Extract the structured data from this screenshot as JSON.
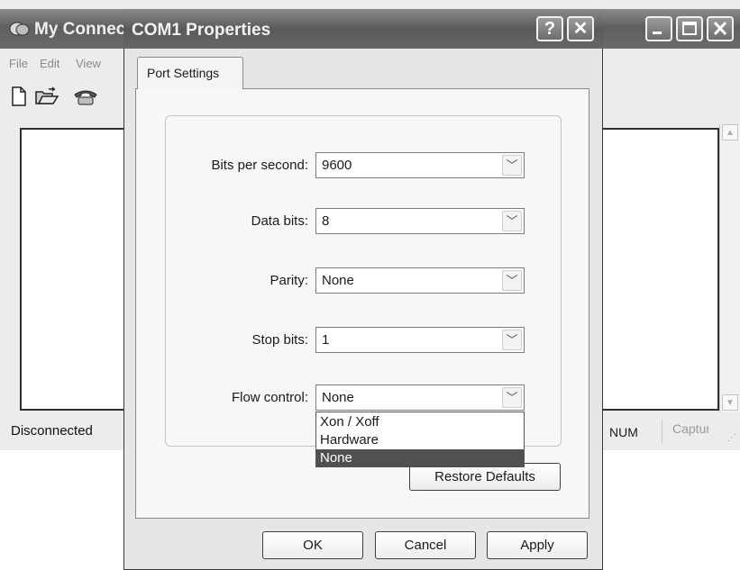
{
  "background_window": {
    "title": "My Connection",
    "menu": [
      "File",
      "Edit",
      "View"
    ],
    "status": {
      "connection": "Disconnected",
      "num": "NUM",
      "capture": "Capture"
    }
  },
  "dialog": {
    "title": "COM1 Properties",
    "help_button": "?",
    "close_button": "✕",
    "tab": "Port Settings",
    "fields": [
      {
        "label": "Bits per second:",
        "value": "9600"
      },
      {
        "label": "Data bits:",
        "value": "8"
      },
      {
        "label": "Parity:",
        "value": "None"
      },
      {
        "label": "Stop bits:",
        "value": "1"
      },
      {
        "label": "Flow control:",
        "value": "None"
      }
    ],
    "flow_control_options": [
      "Xon / Xoff",
      "Hardware",
      "None"
    ],
    "selected_option": "None",
    "restore_defaults": "Restore Defaults",
    "ok": "OK",
    "cancel": "Cancel",
    "apply": "Apply"
  },
  "colors": {
    "titlebar": "#6a6a6a",
    "dialog_face": "#e6e6e6",
    "selection": "#505050"
  }
}
